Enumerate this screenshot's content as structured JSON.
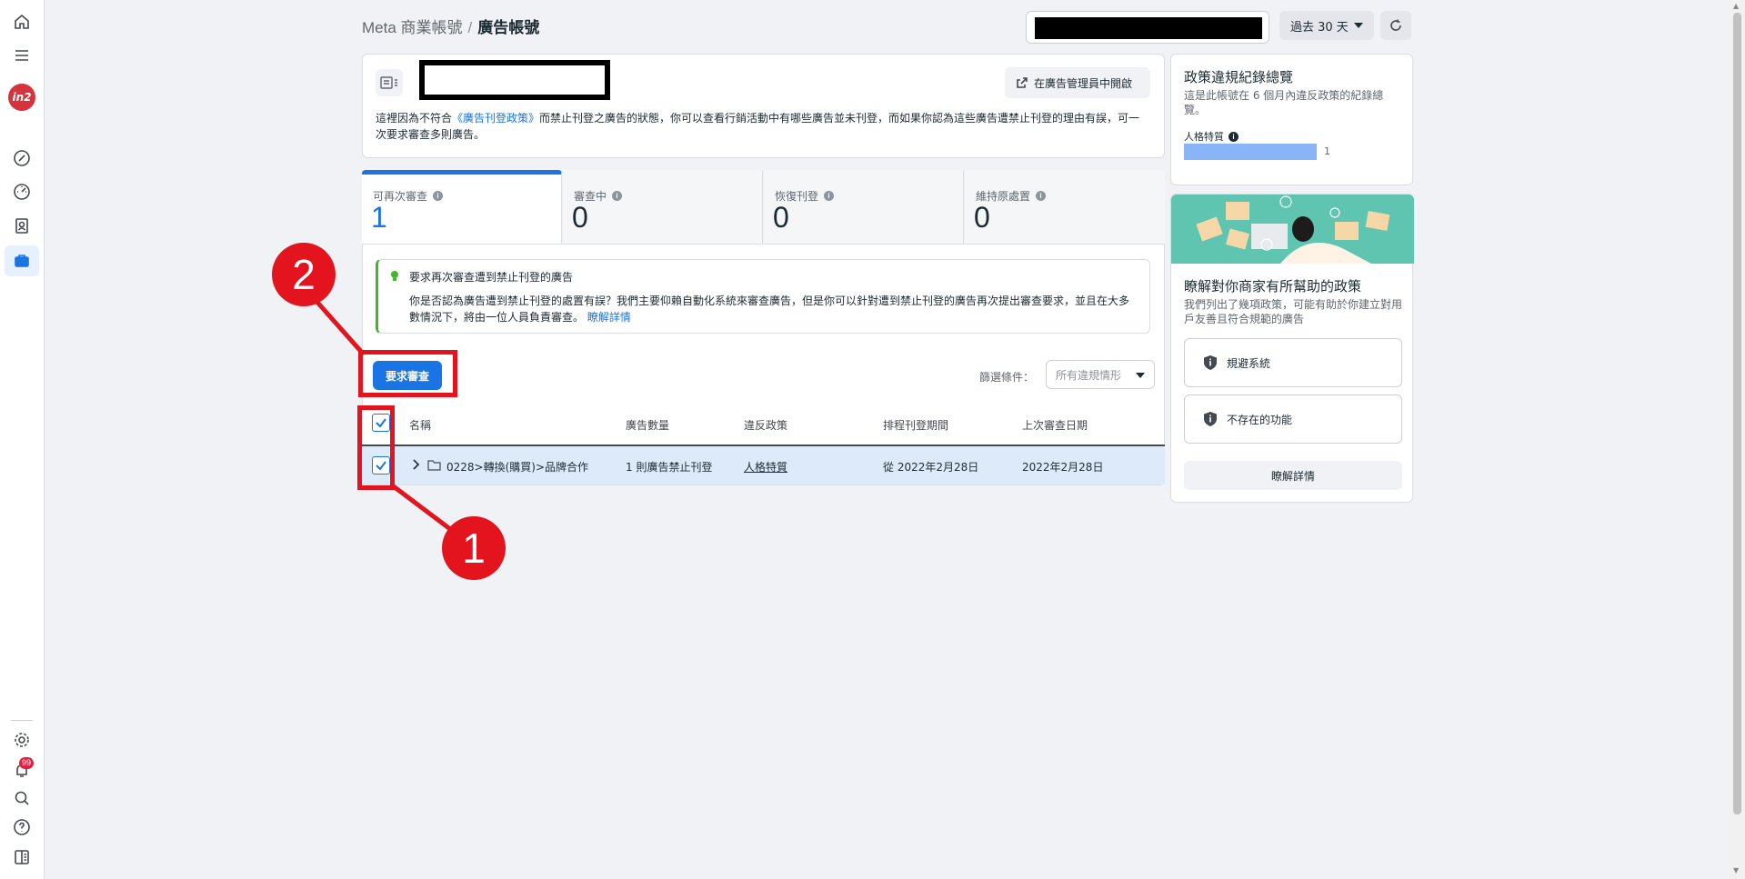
{
  "breadcrumb": {
    "parent": "Meta 商業帳號",
    "separator": "/",
    "current": "廣告帳號"
  },
  "header": {
    "date_range": "過去 30 天"
  },
  "account_card": {
    "open_in_ads_manager": "在廣告管理員中開啟",
    "desc_prefix": "這裡因為不符合",
    "desc_link": "《廣告刊登政策》",
    "desc_suffix": "而禁止刊登之廣告的狀態，你可以查看行銷活動中有哪些廣告並未刊登，而如果你認為這些廣告遭禁止刊登的理由有誤，可一次要求審查多則廣告。"
  },
  "tabs": [
    {
      "label": "可再次審查",
      "value": "1"
    },
    {
      "label": "審查中",
      "value": "0"
    },
    {
      "label": "恢復刊登",
      "value": "0"
    },
    {
      "label": "維持原處置",
      "value": "0"
    }
  ],
  "notice": {
    "title": "要求再次審查遭到禁止刊登的廣告",
    "body": "你是否認為廣告遭到禁止刊登的處置有誤？我們主要仰賴自動化系統來審查廣告，但是你可以針對遭到禁止刊登的廣告再次提出審查要求，並且在大多數情況下，將由一位人員負責審查。",
    "link": "瞭解詳情"
  },
  "actions": {
    "request_review": "要求審查"
  },
  "filter": {
    "label": "篩選條件：",
    "selected": "所有違規情形"
  },
  "table": {
    "headers": [
      "名稱",
      "廣告數量",
      "違反政策",
      "排程刊登期間",
      "上次審查日期"
    ],
    "rows": [
      {
        "name": "0228>轉換(購買)>品牌合作",
        "ad_count": "1 則廣告禁止刊登",
        "policy": "人格特質",
        "schedule": "從 2022年2月28日",
        "last_review": "2022年2月28日",
        "checked": true
      }
    ]
  },
  "annotations": {
    "step1": "1",
    "step2": "2"
  },
  "violation_overview": {
    "title": "政策違規紀錄總覽",
    "desc": "這是此帳號在 6 個月內違反政策的紀錄總覽。",
    "bar_label": "人格特質",
    "bar_value": "1"
  },
  "policies": {
    "title": "瞭解對你商家有所幫助的政策",
    "desc": "我們列出了幾項政策，可能有助於你建立對用戶友善且符合規範的廣告",
    "items": [
      "規避系統",
      "不存在的功能"
    ],
    "learn_more": "瞭解詳情"
  },
  "notifications": {
    "badge": "99"
  },
  "colors": {
    "accent": "#1b74e4",
    "annotation": "#e3141e",
    "row_selected": "#ddeafa"
  }
}
